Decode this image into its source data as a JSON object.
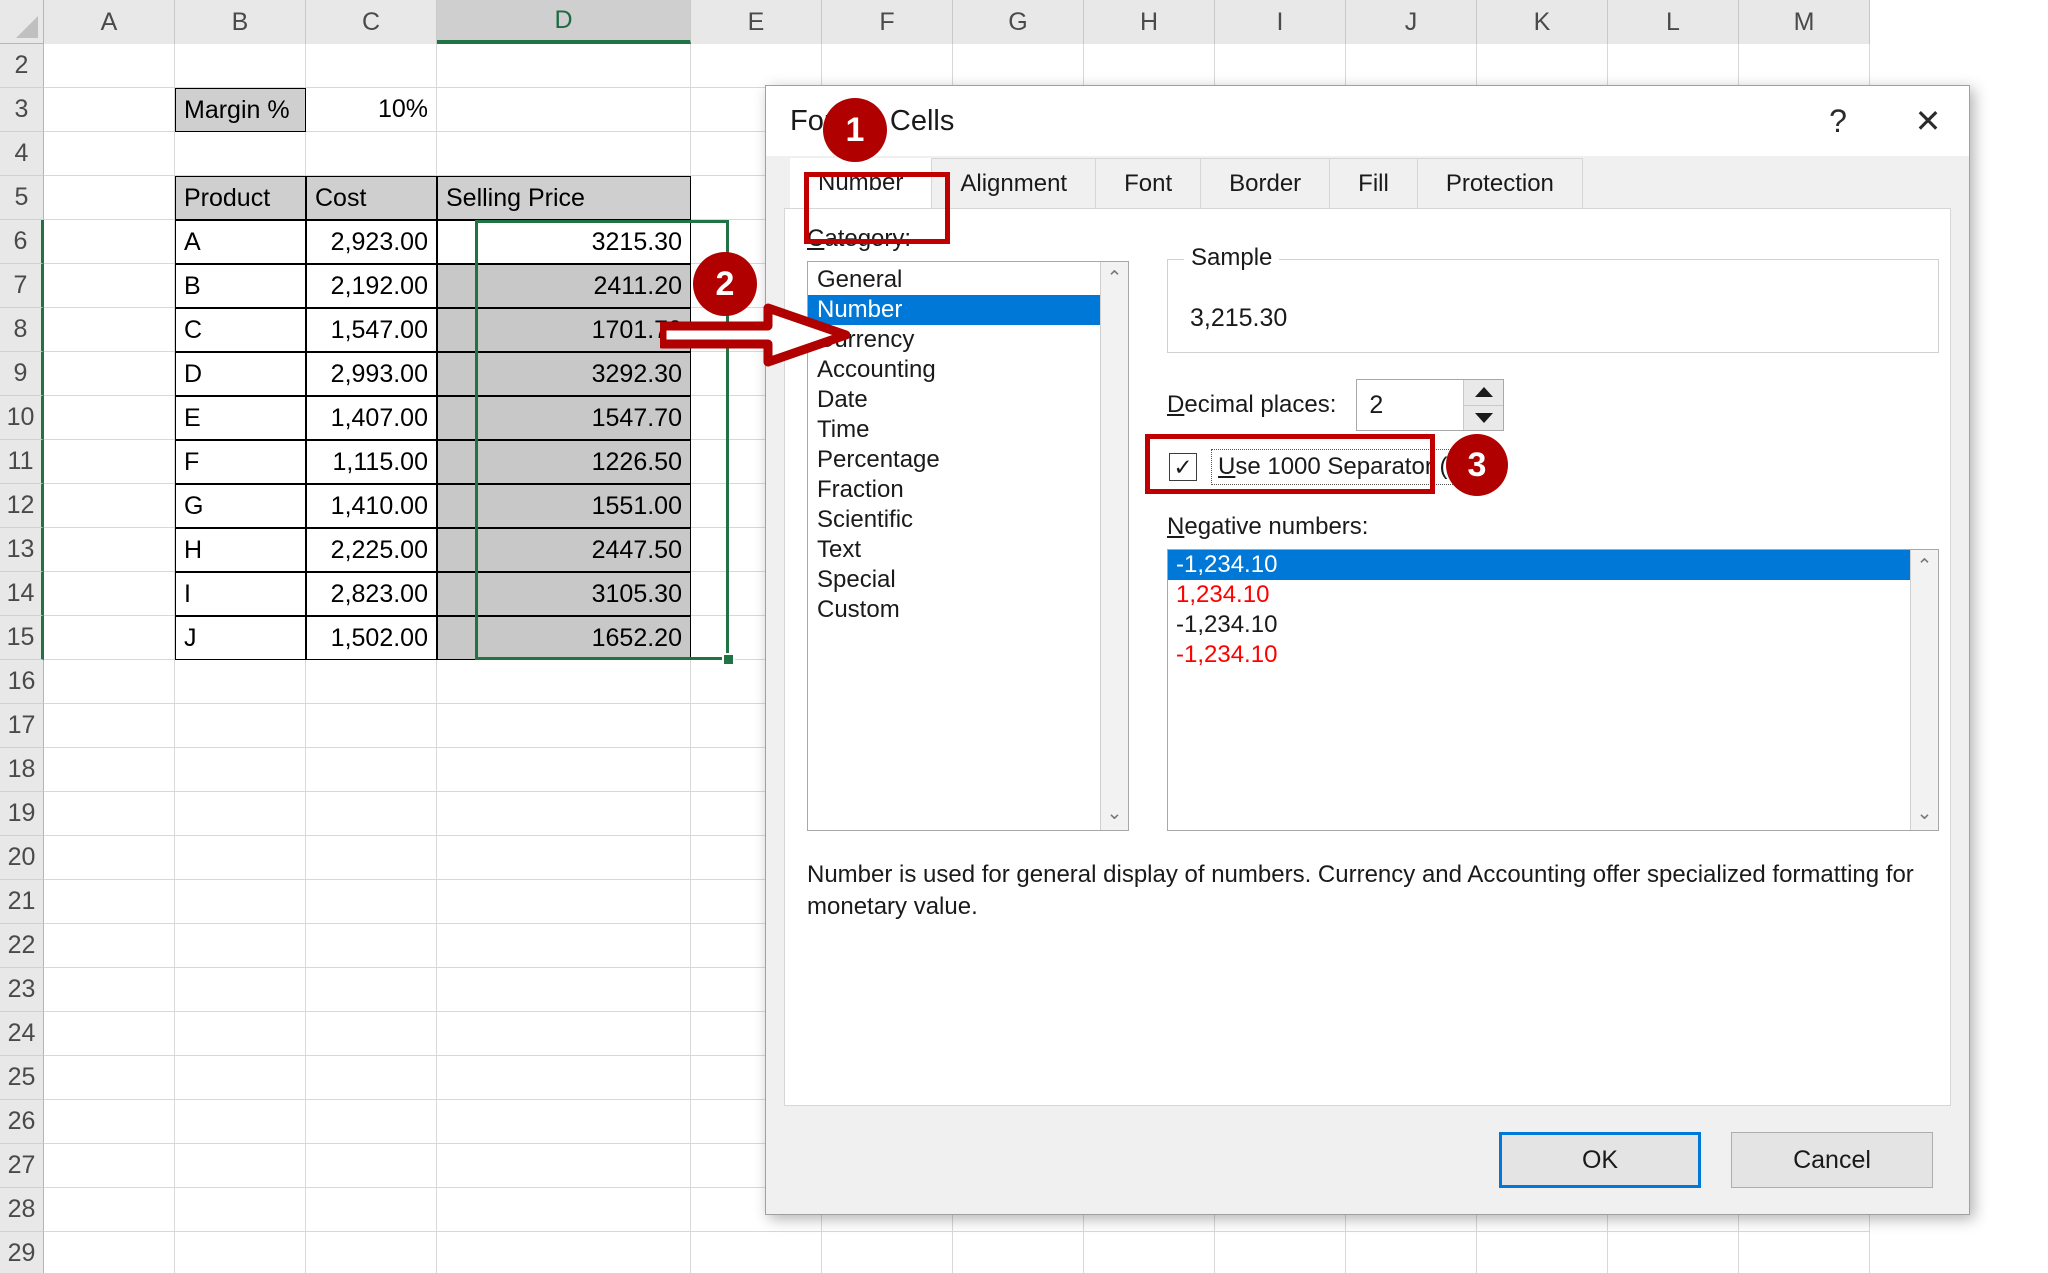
{
  "spreadsheet": {
    "columns": [
      "A",
      "B",
      "C",
      "D",
      "E",
      "F",
      "G",
      "H",
      "I",
      "J",
      "K",
      "L",
      "M"
    ],
    "selected_column": "D",
    "rows": [
      "2",
      "3",
      "4",
      "5",
      "6",
      "7",
      "8",
      "9",
      "10",
      "11",
      "12",
      "13",
      "14",
      "15",
      "16",
      "17",
      "18",
      "19",
      "20",
      "21",
      "22",
      "23",
      "24",
      "25",
      "26",
      "27",
      "28",
      "29"
    ],
    "margin_label": "Margin %",
    "margin_value": "10%",
    "table_headers": [
      "Product",
      "Cost",
      "Selling Price"
    ],
    "table_rows": [
      {
        "product": "A",
        "cost": "2,923.00",
        "price": "3215.30"
      },
      {
        "product": "B",
        "cost": "2,192.00",
        "price": "2411.20"
      },
      {
        "product": "C",
        "cost": "1,547.00",
        "price": "1701.70"
      },
      {
        "product": "D",
        "cost": "2,993.00",
        "price": "3292.30"
      },
      {
        "product": "E",
        "cost": "1,407.00",
        "price": "1547.70"
      },
      {
        "product": "F",
        "cost": "1,115.00",
        "price": "1226.50"
      },
      {
        "product": "G",
        "cost": "1,410.00",
        "price": "1551.00"
      },
      {
        "product": "H",
        "cost": "2,225.00",
        "price": "2447.50"
      },
      {
        "product": "I",
        "cost": "2,823.00",
        "price": "3105.30"
      },
      {
        "product": "J",
        "cost": "1,502.00",
        "price": "1652.20"
      }
    ]
  },
  "dialog": {
    "title": "Format Cells",
    "help_glyph": "?",
    "close_glyph": "✕",
    "tabs": [
      {
        "label": "Number",
        "active": true
      },
      {
        "label": "Alignment",
        "active": false
      },
      {
        "label": "Font",
        "active": false
      },
      {
        "label": "Border",
        "active": false
      },
      {
        "label": "Fill",
        "active": false
      },
      {
        "label": "Protection",
        "active": false
      }
    ],
    "category_label": "Category:",
    "categories": [
      "General",
      "Number",
      "Currency",
      "Accounting",
      "Date",
      "Time",
      "Percentage",
      "Fraction",
      "Scientific",
      "Text",
      "Special",
      "Custom"
    ],
    "selected_category": "Number",
    "sample_legend": "Sample",
    "sample_value": "3,215.30",
    "decimal_label": "Decimal places:",
    "decimal_value": "2",
    "separator_label": "Use 1000 Separator (,)",
    "separator_checked": true,
    "check_glyph": "✓",
    "negative_label": "Negative numbers:",
    "negative_options": [
      {
        "text": "-1,234.10",
        "color": "default",
        "selected": true
      },
      {
        "text": "1,234.10",
        "color": "red",
        "selected": false
      },
      {
        "text": "-1,234.10",
        "color": "default",
        "selected": false
      },
      {
        "text": "-1,234.10",
        "color": "red",
        "selected": false
      }
    ],
    "description": "Number is used for general display of numbers.  Currency and Accounting offer specialized formatting for monetary value.",
    "ok_label": "OK",
    "cancel_label": "Cancel",
    "scroll_up_glyph": "⌃",
    "scroll_down_glyph": "⌄"
  },
  "annotations": {
    "badge1": "1",
    "badge2": "2",
    "badge3": "3",
    "accent_color": "#b00000",
    "highlight_color": "#c00000"
  }
}
